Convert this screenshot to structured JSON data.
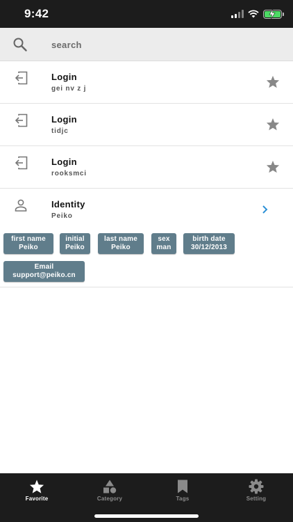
{
  "status_bar": {
    "time": "9:42"
  },
  "search": {
    "placeholder": "search"
  },
  "entries": [
    {
      "type": "login",
      "title": "Login",
      "subtitle": "gei nv z j"
    },
    {
      "type": "login",
      "title": "Login",
      "subtitle": "tidjc"
    },
    {
      "type": "login",
      "title": "Login",
      "subtitle": "rooksmci"
    }
  ],
  "identity": {
    "title": "Identity",
    "subtitle": "Peiko",
    "fields": [
      {
        "label": "first name",
        "value": "Peiko"
      },
      {
        "label": "initial",
        "value": "Peiko"
      },
      {
        "label": "last name",
        "value": "Peiko"
      },
      {
        "label": "sex",
        "value": "man"
      },
      {
        "label": "birth date",
        "value": "30/12/2013"
      },
      {
        "label": "Email",
        "value": "support@peiko.cn"
      }
    ]
  },
  "tab_bar": {
    "tabs": [
      {
        "label": "Favorite",
        "icon": "star-icon",
        "active": true
      },
      {
        "label": "Category",
        "icon": "shapes-icon",
        "active": false
      },
      {
        "label": "Tags",
        "icon": "bookmark-icon",
        "active": false
      },
      {
        "label": "Setting",
        "icon": "gear-icon",
        "active": false
      }
    ]
  },
  "colors": {
    "chip_background": "#607d8b",
    "accent_chevron": "#2a8fd6",
    "star": "#888888",
    "bars": "#1c1c1c",
    "battery": "#4cd964"
  }
}
